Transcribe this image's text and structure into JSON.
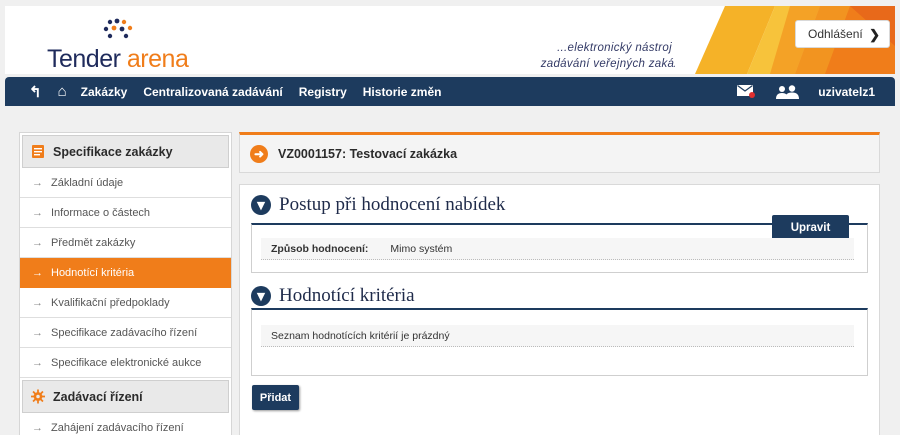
{
  "header": {
    "logo_word1": "Tender",
    "logo_word2": "arena",
    "tagline_line1": "...elektronický nástroj pro",
    "tagline_line2": "zadávání veřejných zakázek",
    "login_label": "Odhlášení",
    "login_chevron": "❯"
  },
  "colors": {
    "navy": "#1d3b5e",
    "orange": "#f07d1a"
  },
  "nav": {
    "back_icon": "↰",
    "home_icon": "⌂",
    "items": [
      "Zakázky",
      "Centralizovaná zadávání",
      "Registry",
      "Historie změn"
    ],
    "username": "uzivatelz1"
  },
  "sidebar": {
    "section1_title": "Specifikace zakázky",
    "items": [
      "Základní údaje",
      "Informace o částech",
      "Předmět zakázky",
      "Hodnotící kritéria",
      "Kvalifikační předpoklady",
      "Specifikace zadávacího řízení",
      "Specifikace elektronické aukce"
    ],
    "active_index": 3,
    "section2_title": "Zadávací řízení",
    "section2_items": [
      "Zahájení zadávacího řízení"
    ],
    "arrow": "→"
  },
  "main": {
    "title": "VZ0001157: Testovací zakázka",
    "sections": [
      {
        "title": "Postup při hodnocení nabídek",
        "edit_label": "Upravit",
        "row_label": "Způsob hodnocení:",
        "row_value": "Mimo systém"
      },
      {
        "title": "Hodnotící kritéria",
        "row_text": "Seznam hodnotících kritérií je prázdný"
      }
    ],
    "add_label": "Přidat"
  }
}
